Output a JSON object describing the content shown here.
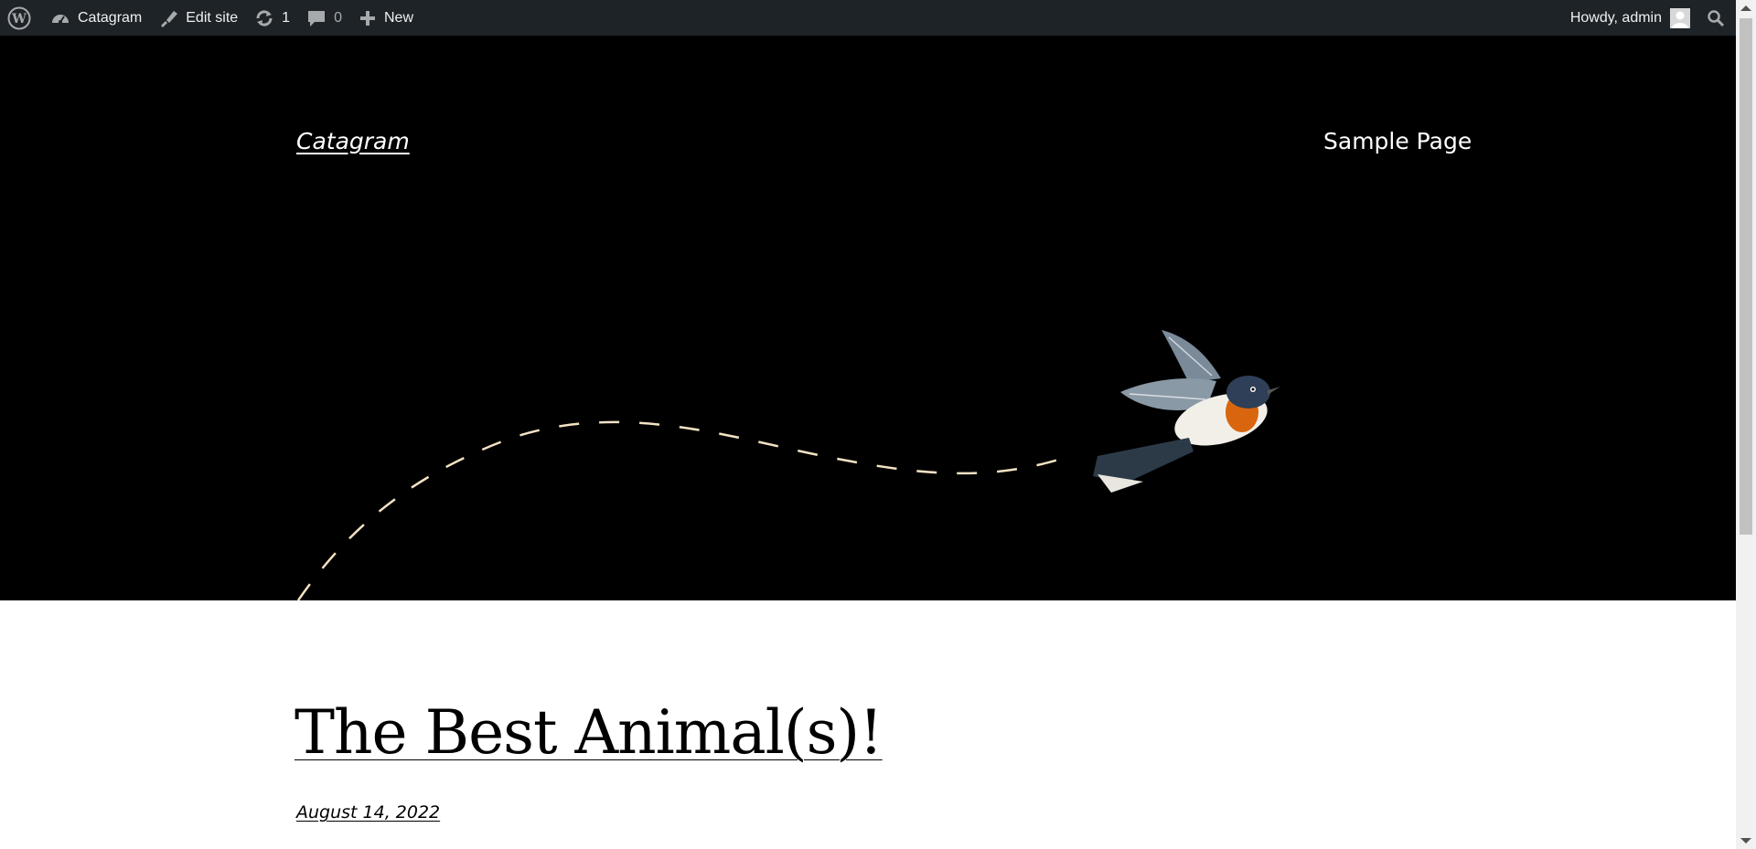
{
  "adminbar": {
    "site_name": "Catagram",
    "edit_site": "Edit site",
    "updates_count": "1",
    "comments_count": "0",
    "new_label": "New",
    "greeting": "Howdy, admin",
    "icons": {
      "logo": "wordpress-logo-icon",
      "site": "dashboard-icon",
      "edit": "brush-icon",
      "updates": "refresh-icon",
      "comments": "comment-bubble-icon",
      "new": "plus-icon",
      "avatar": "avatar-icon",
      "search": "search-icon"
    },
    "background": "#1d2327"
  },
  "header": {
    "site_title": "Catagram",
    "nav": [
      {
        "label": "Sample Page"
      }
    ],
    "background": "#000000",
    "path_color": "#f3e2c4"
  },
  "post": {
    "title": "The Best Animal(s)!",
    "date": "August 14, 2022"
  }
}
